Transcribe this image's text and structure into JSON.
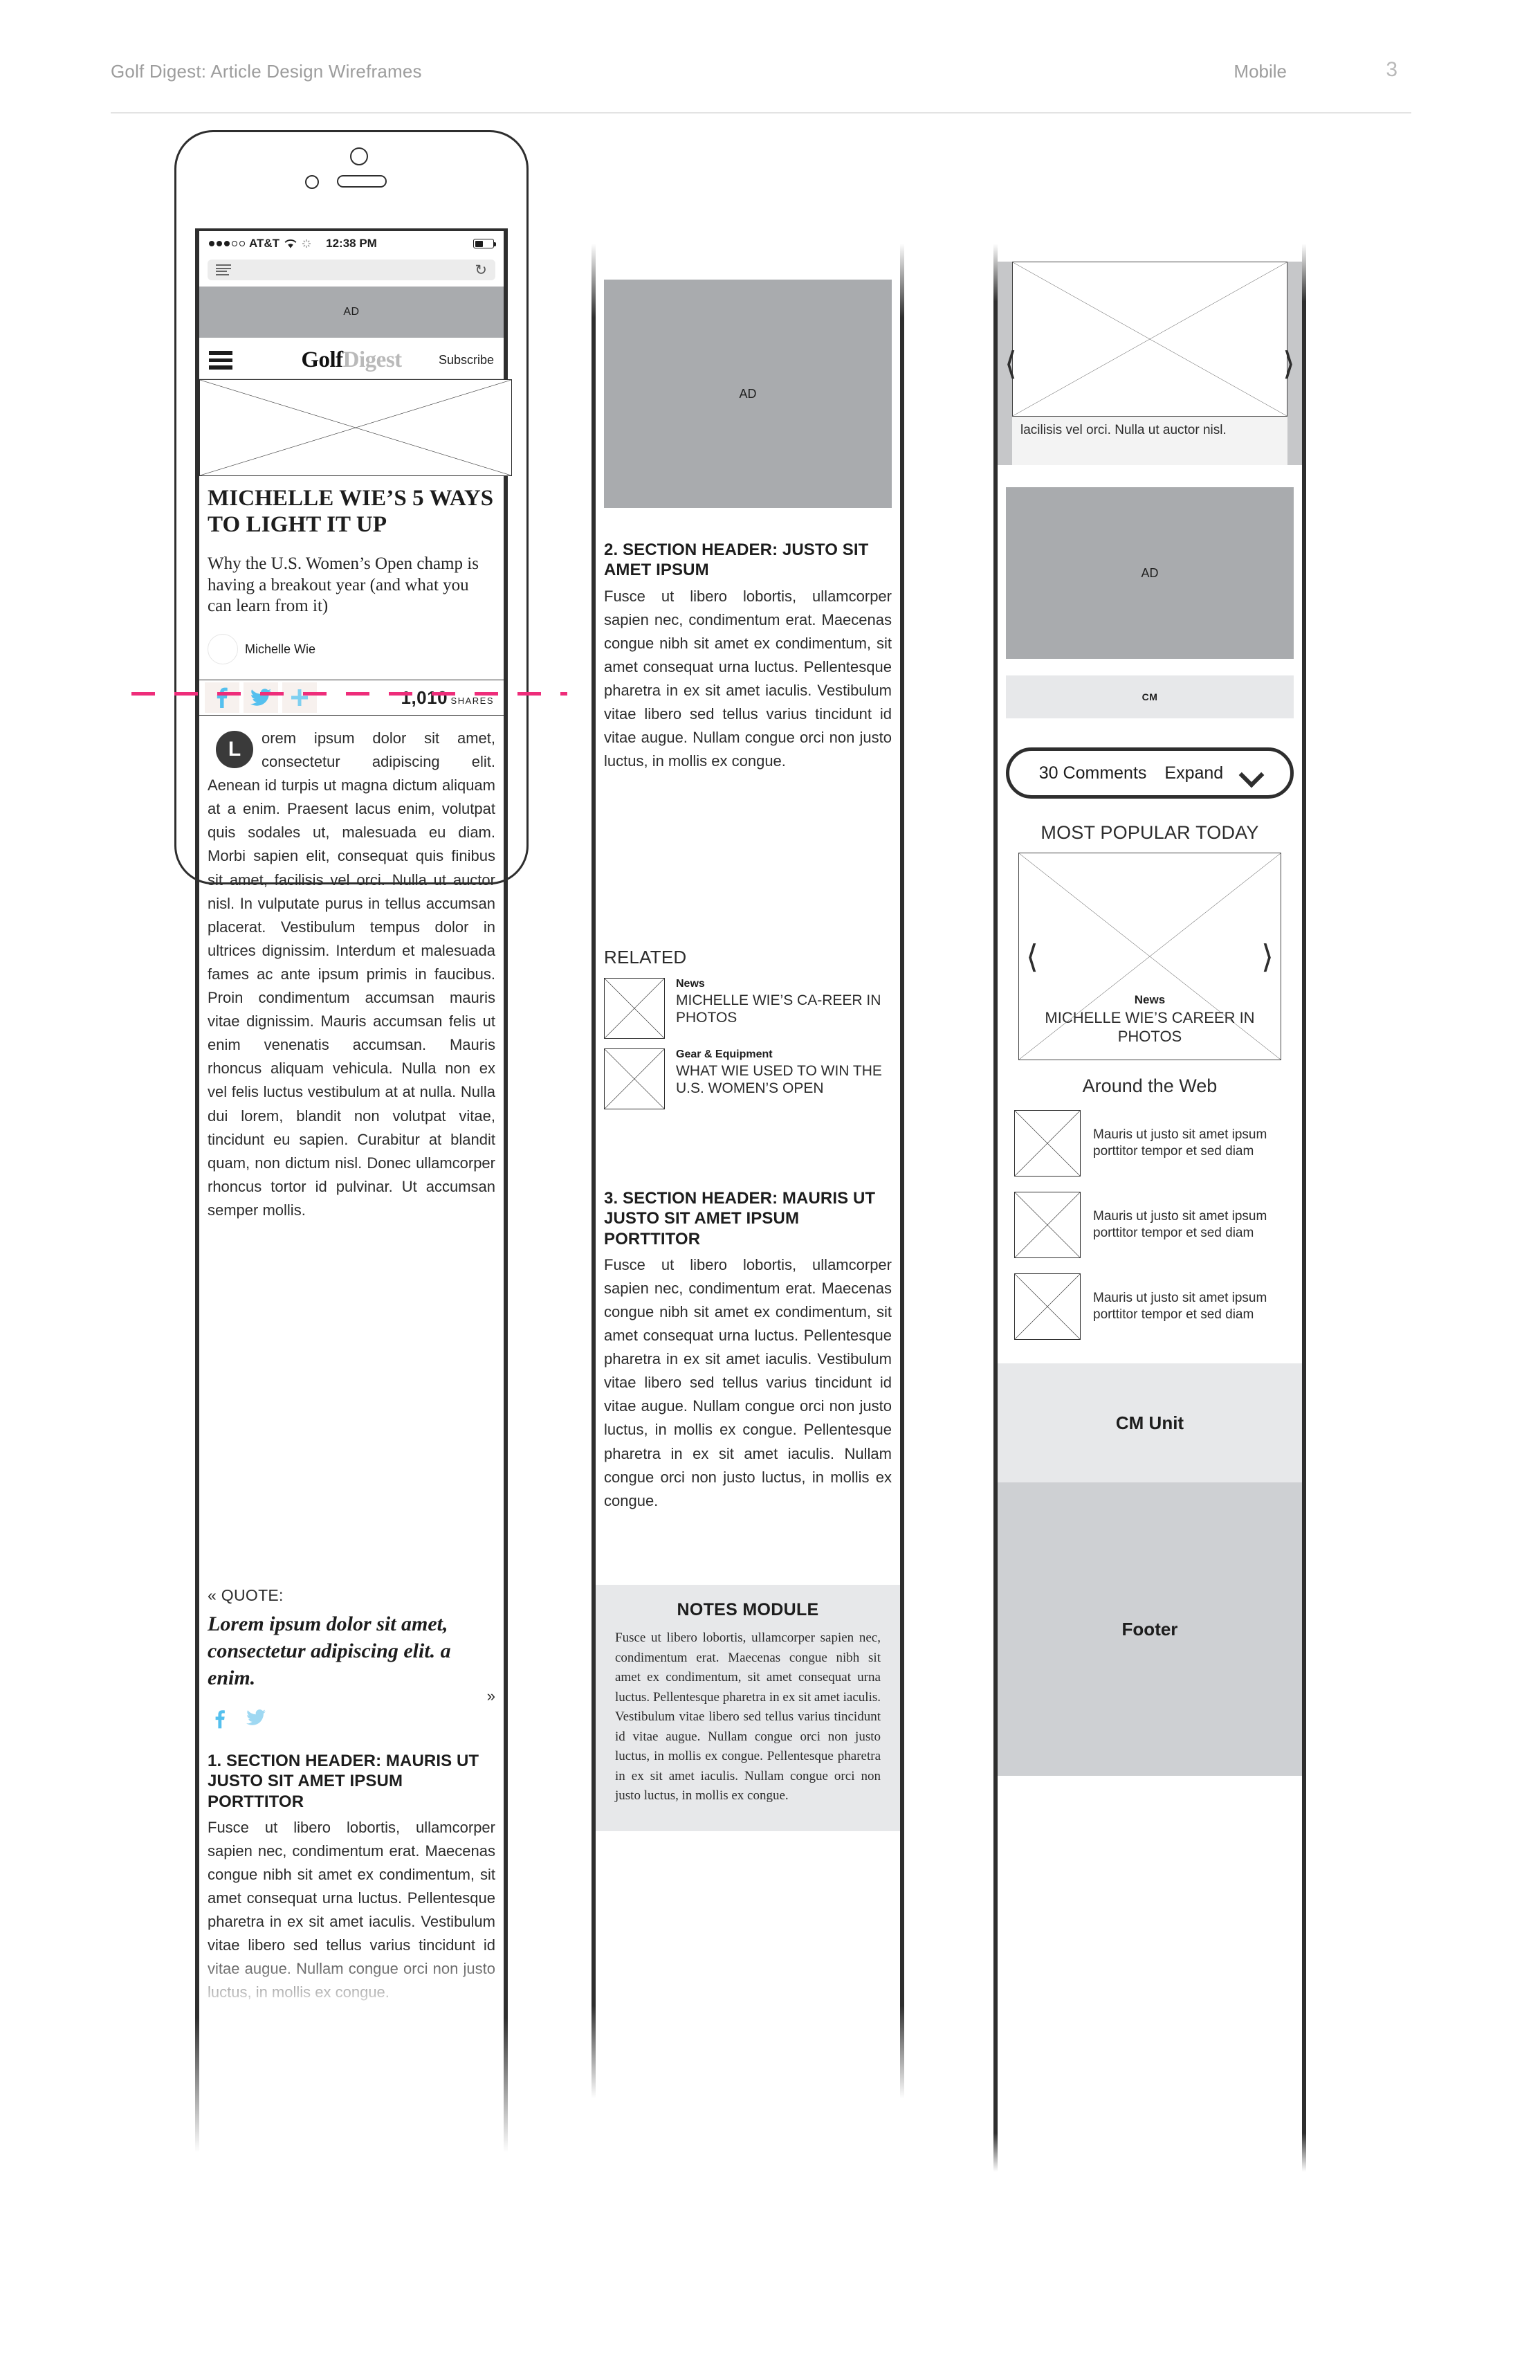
{
  "header": {
    "title": "Golf Digest: Article Design Wireframes",
    "platform": "Mobile",
    "page_number": "3"
  },
  "device": {
    "status_bar": {
      "carrier": "AT&T",
      "time": "12:38 PM"
    },
    "browser": {
      "reader_icon": "reader-view-icon",
      "refresh_icon": "refresh-icon"
    }
  },
  "column1": {
    "ad_banner_label": "AD",
    "nav": {
      "menu_icon": "hamburger-menu-icon",
      "brand_part1": "Golf",
      "brand_part2": "Digest",
      "subscribe_label": "Subscribe"
    },
    "headline": "MICHELLE WIE’S 5 WAYS TO LIGHT IT UP",
    "deck": "Why the U.S. Women’s Open champ is having a breakout year (and what you can learn from it)",
    "byline": "Michelle Wie",
    "share": {
      "facebook_icon": "facebook-icon",
      "twitter_icon": "twitter-icon",
      "plus_icon": "plus-icon",
      "count": "1,010",
      "count_label": "SHARES"
    },
    "dropcap": "L",
    "body": "orem ipsum dolor sit amet, consectetur adipiscing elit. Aenean id turpis ut magna dictum aliquam at a enim. Praesent lacus enim, volutpat quis sodales ut, malesuada eu diam. Morbi sapien elit, consequat quis finibus sit amet, facilisis vel orci. Nulla ut auctor nisl. In vulputate purus in tellus accumsan placerat. Vestibulum tempus dolor in ultrices dignissim. Interdum et malesuada fames ac ante ipsum primis in faucibus. Proin condimentum accumsan mauris vitae dignissim. Mauris accumsan felis ut enim venenatis accumsan. Mauris rhoncus aliquam vehicula. Nulla non ex vel felis luctus vestibulum at at nulla. Nulla dui lorem, blandit non volutpat vitae, tincidunt eu sapien. Curabitur at blandit quam, non dictum nisl. Donec ullamcorper rhoncus tortor id pulvinar. Ut accumsan semper mollis.",
    "quote": {
      "label": "« QUOTE:",
      "text": "Lorem ipsum dolor sit amet, consectetur adipiscing elit. a enim.",
      "close_mark": "»",
      "facebook_icon": "facebook-icon",
      "twitter_icon": "twitter-icon"
    },
    "section1": {
      "heading": "1. SECTION HEADER: MAURIS UT JUSTO SIT AMET IPSUM PORTTITOR",
      "body": "Fusce ut libero lobortis, ullamcorper sapien nec, condimentum erat. Maecenas congue nibh sit amet ex condimentum, sit amet consequat urna luctus. Pellentesque pharetra in ex sit amet iaculis. Vestibulum vitae libero sed tellus varius tincidunt id vitae augue. Nullam congue orci non justo luctus, in mollis ex congue."
    }
  },
  "column2": {
    "ad_label": "AD",
    "section2": {
      "heading": "2. SECTION HEADER: JUSTO SIT AMET IPSUM",
      "body": "Fusce ut libero lobortis, ullamcorper sapien nec, condimentum erat. Maecenas congue nibh sit amet ex condimentum, sit amet consequat urna luctus. Pellentesque pharetra in ex sit amet iaculis. Vestibulum vitae libero sed tellus varius tincidunt id vitae augue. Nullam congue orci non justo luctus, in mollis ex congue."
    },
    "related": {
      "title": "RELATED",
      "items": [
        {
          "kicker": "News",
          "headline": "MICHELLE WIE’S CA-REER IN PHOTOS"
        },
        {
          "kicker": "Gear & Equipment",
          "headline": "WHAT WIE USED TO WIN THE U.S. WOMEN’S OPEN"
        }
      ]
    },
    "section3": {
      "heading": "3. SECTION HEADER: MAURIS UT JUSTO SIT AMET IPSUM PORTTITOR",
      "body": "Fusce ut libero lobortis, ullamcorper sapien nec, condimentum erat. Maecenas congue nibh sit amet ex condimentum, sit amet consequat urna luctus. Pellentesque pharetra in ex sit amet iaculis. Vestibulum vitae libero sed tellus varius tincidunt id vitae augue. Nullam congue orci non justo luctus, in mollis ex congue. Pellentesque pharetra in ex sit amet iaculis. Nullam congue orci non justo luctus, in mollis ex congue."
    },
    "notes": {
      "title": "NOTES MODULE",
      "body": "Fusce ut libero lobortis, ullamcorper sapien nec, condimentum erat. Maecenas congue nibh sit amet ex condimentum, sit amet consequat urna luctus. Pellentesque pharetra in ex sit amet iaculis. Vestibulum vitae libero sed tellus varius tincidunt id vitae augue. Nullam congue orci non justo luctus, in mollis ex congue. Pellentesque pharetra in ex sit amet iaculis. Nullam congue orci non justo luctus, in mollis ex congue."
    }
  },
  "column3": {
    "carousel": {
      "caption": "lacilisis vel orci. Nulla ut auctor nisl.",
      "prev_icon": "chevron-left-icon",
      "next_icon": "chevron-right-icon"
    },
    "ad_label": "AD",
    "cm_bar_label": "CM",
    "comments": {
      "count_label": "30 Comments",
      "expand_label": "Expand",
      "caret_icon": "chevron-down-icon"
    },
    "most_popular": {
      "title": "MOST POPULAR TODAY",
      "kicker": "News",
      "headline": "MICHELLE WIE’S CAREER IN PHOTOS",
      "prev_icon": "chevron-left-icon",
      "next_icon": "chevron-right-icon"
    },
    "around_the_web": {
      "title": "Around the Web",
      "items": [
        "Mauris ut justo sit amet ipsum porttitor tempor et sed diam",
        "Mauris ut justo sit amet ipsum porttitor tempor et sed diam",
        "Mauris ut justo sit amet ipsum porttitor tempor et sed diam"
      ]
    },
    "cm_unit_label": "CM Unit",
    "footer_label": "Footer"
  },
  "colors": {
    "ad_gray": "#a9abae",
    "module_gray": "#e7e8ea",
    "footer_gray": "#ced0d3",
    "fold_line": "#ee2d7a",
    "social_blue": "#55c0ee",
    "ink": "#2e2e2e"
  }
}
